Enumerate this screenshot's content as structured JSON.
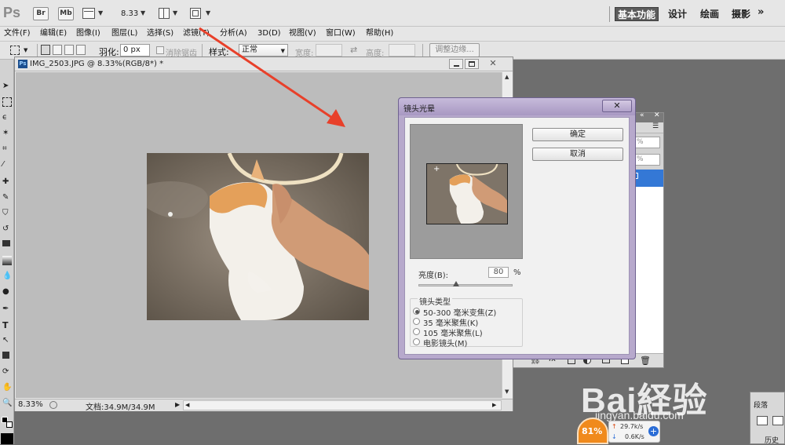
{
  "appbar": {
    "logo": "Ps",
    "icons": [
      "Br",
      "Mb"
    ],
    "zoom_value": "8.33",
    "workspaces": [
      "基本功能",
      "设计",
      "绘画",
      "摄影"
    ],
    "more": "»"
  },
  "menus": [
    "文件(F)",
    "编辑(E)",
    "图像(I)",
    "图层(L)",
    "选择(S)",
    "滤镜(T)",
    "分析(A)",
    "3D(D)",
    "视图(V)",
    "窗口(W)",
    "帮助(H)"
  ],
  "options": {
    "feather_label": "羽化:",
    "feather_value": "0 px",
    "antialias_label": "消除锯齿",
    "style_label": "样式:",
    "style_value": "正常",
    "width_label": "宽度:",
    "height_label": "高度:",
    "refine_edge": "调整边缘..."
  },
  "document": {
    "title": "IMG_2503.JPG @ 8.33%(RGB/8*) *",
    "zoom": "8.33%",
    "doc_info": "文档:34.9M/34.9M"
  },
  "dialog": {
    "title": "镜头光晕",
    "ok": "确定",
    "cancel": "取消",
    "brightness_label": "亮度(B):",
    "brightness_value": "80",
    "brightness_unit": "%",
    "brightness_level": 80,
    "lens_type_label": "镜头类型",
    "lens_options": [
      "50-300 毫米变焦(Z)",
      "35 毫米聚焦(K)",
      "105 毫米聚焦(L)",
      "电影镜头(M)"
    ],
    "selected_lens": 0
  },
  "right_panel": {
    "pct1": "%",
    "pct2": "%",
    "bottom_tab1": "段落",
    "bottom_tab2": "历史"
  },
  "network": {
    "percent": "81%",
    "up_speed": "29.7k/s",
    "down_speed": "0.6K/s"
  },
  "watermark": {
    "logo": "Bai経验",
    "url": "jingyan.baidu.com"
  },
  "colors": {
    "dialog_frame": "#b7a9cc",
    "arrow": "#e8402a",
    "active_workspace": "#5c5c5c",
    "selection_blue": "#3478d6"
  }
}
